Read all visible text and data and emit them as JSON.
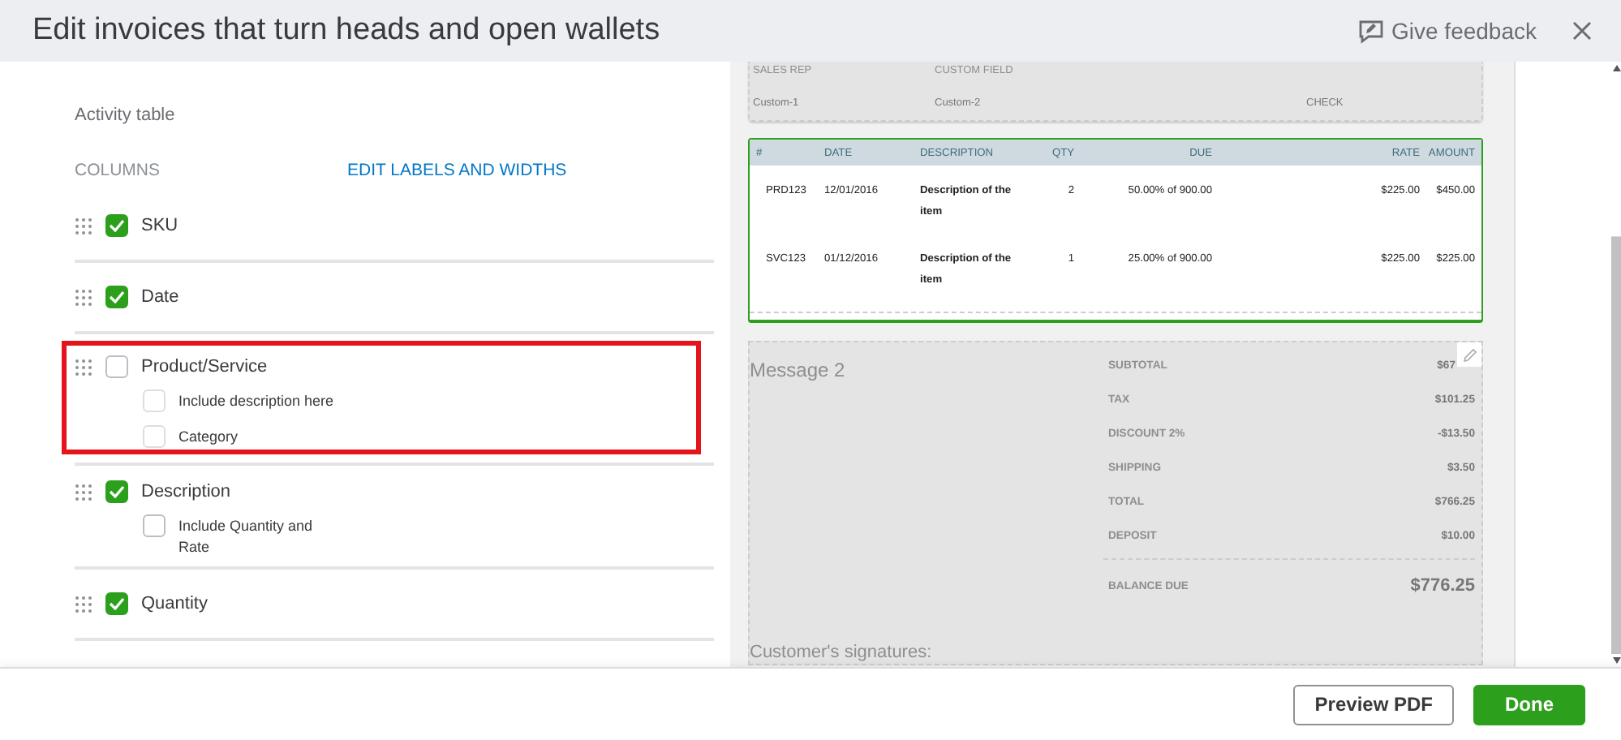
{
  "header": {
    "title": "Edit invoices that turn heads and open wallets",
    "feedback": "Give feedback"
  },
  "settings": {
    "section": "Activity table",
    "columns_label": "COLUMNS",
    "edit_link": "EDIT LABELS AND WIDTHS",
    "columns": [
      {
        "label": "SKU",
        "checked": true,
        "highlighted": false
      },
      {
        "label": "Date",
        "checked": true,
        "highlighted": false
      },
      {
        "label": "Product/Service",
        "checked": false,
        "highlighted": true,
        "children": [
          {
            "label": "Include description here",
            "checked": false
          },
          {
            "label": "Category",
            "checked": false
          }
        ]
      },
      {
        "label": "Description",
        "checked": true,
        "highlighted": false,
        "children": [
          {
            "label": "Include Quantity and Rate",
            "checked": false
          }
        ]
      },
      {
        "label": "Quantity",
        "checked": true,
        "highlighted": false
      }
    ]
  },
  "preview": {
    "fields": [
      {
        "label": "SALES REP",
        "value": "Custom-1"
      },
      {
        "label": "CUSTOM FIELD",
        "value": "Custom-2"
      },
      {
        "value": "CHECK"
      }
    ],
    "table": {
      "columns": [
        "#",
        "DATE",
        "DESCRIPTION",
        "QTY",
        "DUE",
        "RATE",
        "AMOUNT"
      ],
      "rows": [
        [
          "PRD123",
          "12/01/2016",
          "Description of the item",
          "2",
          "50.00% of 900.00",
          "$225.00",
          "$450.00"
        ],
        [
          "SVC123",
          "01/12/2016",
          "Description of the item",
          "1",
          "25.00% of 900.00",
          "$225.00",
          "$225.00"
        ]
      ]
    },
    "message": "Message 2",
    "totals": [
      {
        "label": "SUBTOTAL",
        "value": "$67"
      },
      {
        "label": "TAX",
        "value": "$101.25"
      },
      {
        "label": "DISCOUNT 2%",
        "value": "-$13.50"
      },
      {
        "label": "SHIPPING",
        "value": "$3.50"
      },
      {
        "label": "TOTAL",
        "value": "$766.25"
      },
      {
        "label": "DEPOSIT",
        "value": "$10.00"
      }
    ],
    "balance": {
      "label": "BALANCE DUE",
      "value": "$776.25"
    },
    "signature": "Customer's signatures:"
  },
  "footer": {
    "buttons": [
      {
        "label": "Preview PDF",
        "kind": "secondary"
      },
      {
        "label": "Done",
        "kind": "primary"
      }
    ]
  }
}
